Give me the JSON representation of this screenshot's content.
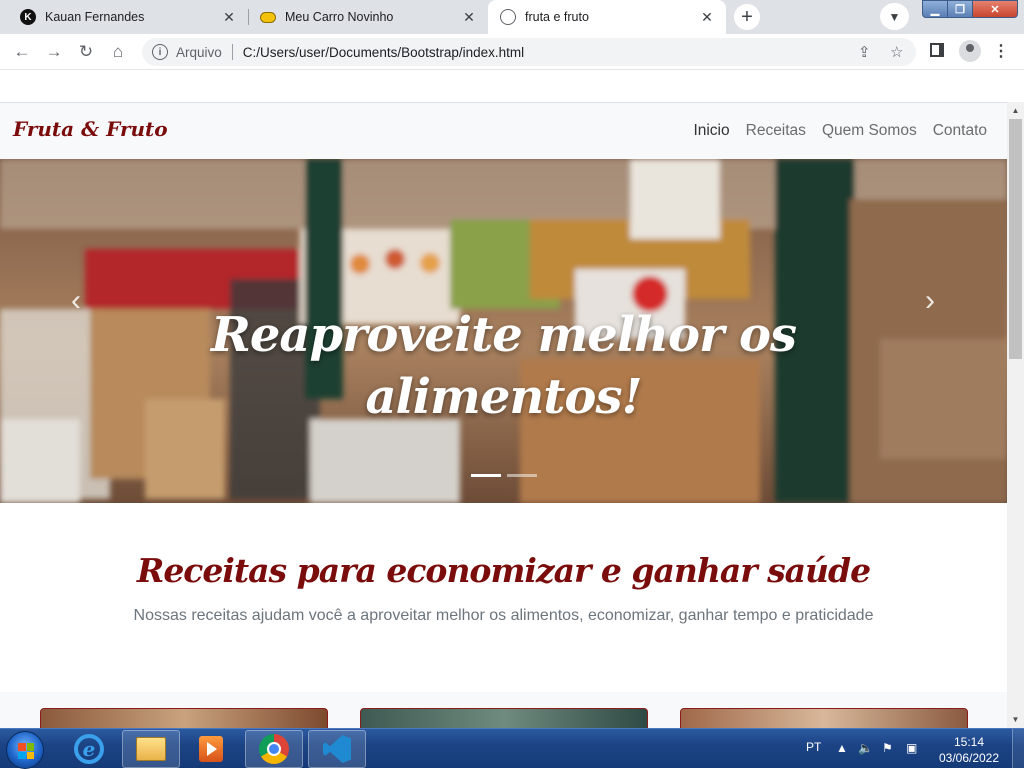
{
  "browser": {
    "tabs": [
      {
        "title": "Kauan Fernandes",
        "favicon": "k-avatar-icon"
      },
      {
        "title": "Meu Carro Novinho",
        "favicon": "car-icon"
      },
      {
        "title": "fruta e fruto",
        "favicon": "globe-icon"
      }
    ],
    "active_tab": 2,
    "address": {
      "scheme_label": "Arquivo",
      "url": "C:/Users/user/Documents/Bootstrap/index.html"
    }
  },
  "site": {
    "brand": "Fruta & Fruto",
    "nav": [
      "Inicio",
      "Receitas",
      "Quem Somos",
      "Contato"
    ],
    "active_nav": 0,
    "hero": {
      "line1": "Reaproveite melhor os",
      "line2": "alimentos!"
    },
    "section": {
      "title": "Receitas para economizar e ganhar saúde",
      "subtitle": "Nossas receitas ajudam você a aproveitar melhor os alimentos, economizar, ganhar tempo e praticidade"
    }
  },
  "taskbar": {
    "language": "PT",
    "time": "15:14",
    "date": "03/06/2022"
  },
  "colors": {
    "brand_red": "#7a0c0c",
    "nav_bg": "#f8f9fa",
    "taskbar_blue": "#1c4485"
  }
}
